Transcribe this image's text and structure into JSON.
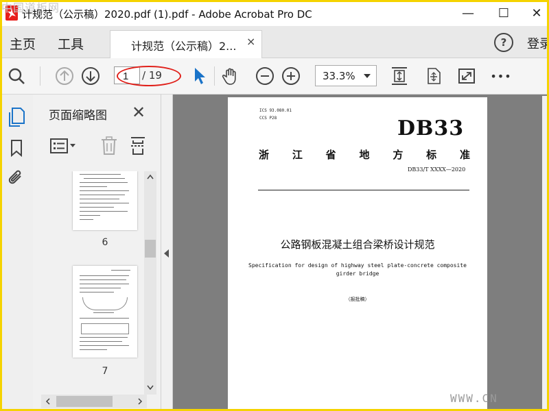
{
  "window": {
    "title": "计规范（公示稿）2020.pdf (1).pdf - Adobe Acrobat Pro DC",
    "watermark_top": "中国道板网",
    "minimize": "—",
    "maximize": "☐",
    "close": "✕"
  },
  "tabs": {
    "home": "主页",
    "tools": "工具",
    "document": "计规范（公示稿）2...",
    "document_close": "×",
    "help": "?",
    "login": "登录"
  },
  "toolbar": {
    "page_current": "1",
    "page_total": "/ 19",
    "zoom": "33.3%",
    "more": "•••",
    "icons": [
      "search-icon",
      "prev-page-icon",
      "next-page-icon",
      "select-arrow-icon",
      "hand-icon",
      "zoom-out-icon",
      "zoom-in-icon",
      "fit-page-icon",
      "rotate-icon",
      "fullscreen-icon",
      "more-icon"
    ]
  },
  "sidebar": {
    "panel_title": "页面缩略图",
    "panel_close": "✕",
    "thumbnails": [
      {
        "label": "6"
      },
      {
        "label": "7"
      }
    ],
    "rail_icons": [
      "pages-icon",
      "bookmark-icon",
      "attachment-icon"
    ]
  },
  "document": {
    "ics": "ICS 93.080.01",
    "ccs": "CCS P28",
    "db": "DB33",
    "standard_chars": [
      "浙",
      "江",
      "省",
      "地",
      "方",
      "标",
      "准"
    ],
    "code": "DB33/T XXXX—2020",
    "title_cn": "公路钢板混凝土组合梁桥设计规范",
    "title_en_1": "Specification for design of highway steel plate-concrete composite",
    "title_en_2": "girder bridge",
    "draft": "（报批稿）"
  },
  "watermark_bottom": "WWW.CN"
}
